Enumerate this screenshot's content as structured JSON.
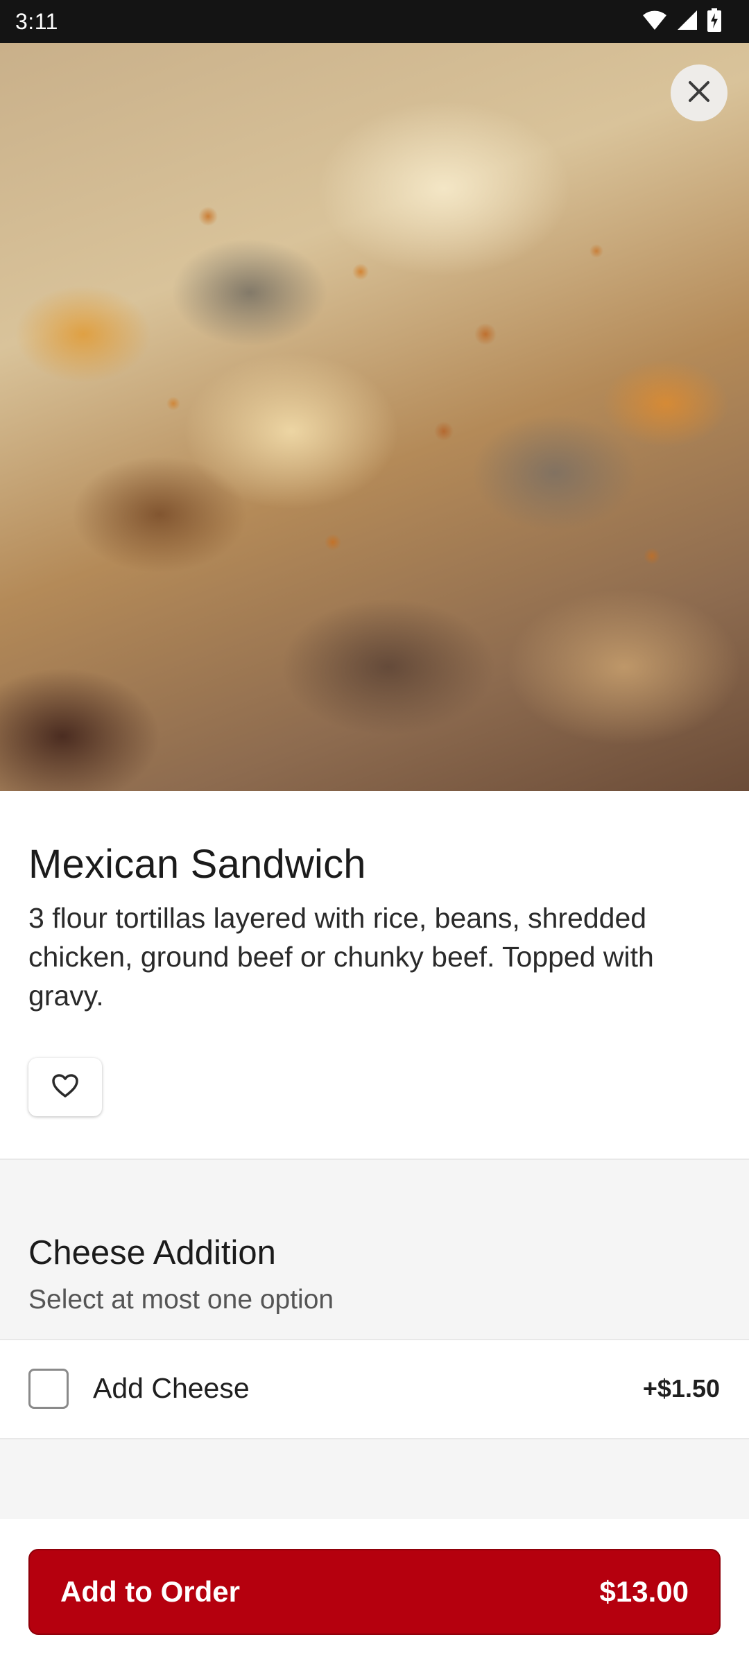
{
  "status_bar": {
    "time": "3:11",
    "icons": [
      "wifi-icon",
      "signal-icon",
      "battery-charging-icon"
    ]
  },
  "hero": {
    "close_icon": "close-icon"
  },
  "item": {
    "title": "Mexican Sandwich",
    "description": "3 flour tortillas layered with rice, beans, shredded chicken, ground beef or chunky beef. Topped with gravy.",
    "favorite_icon": "heart-outline-icon"
  },
  "option_group": {
    "title": "Cheese Addition",
    "subtitle": "Select at most one option",
    "options": [
      {
        "label": "Add Cheese",
        "price": "+$1.50",
        "checked": false
      }
    ]
  },
  "footer": {
    "add_label": "Add to Order",
    "total": "$13.00"
  },
  "colors": {
    "accent": "#b5000e",
    "status_bar": "#141414",
    "section_bg": "#f5f5f5"
  }
}
